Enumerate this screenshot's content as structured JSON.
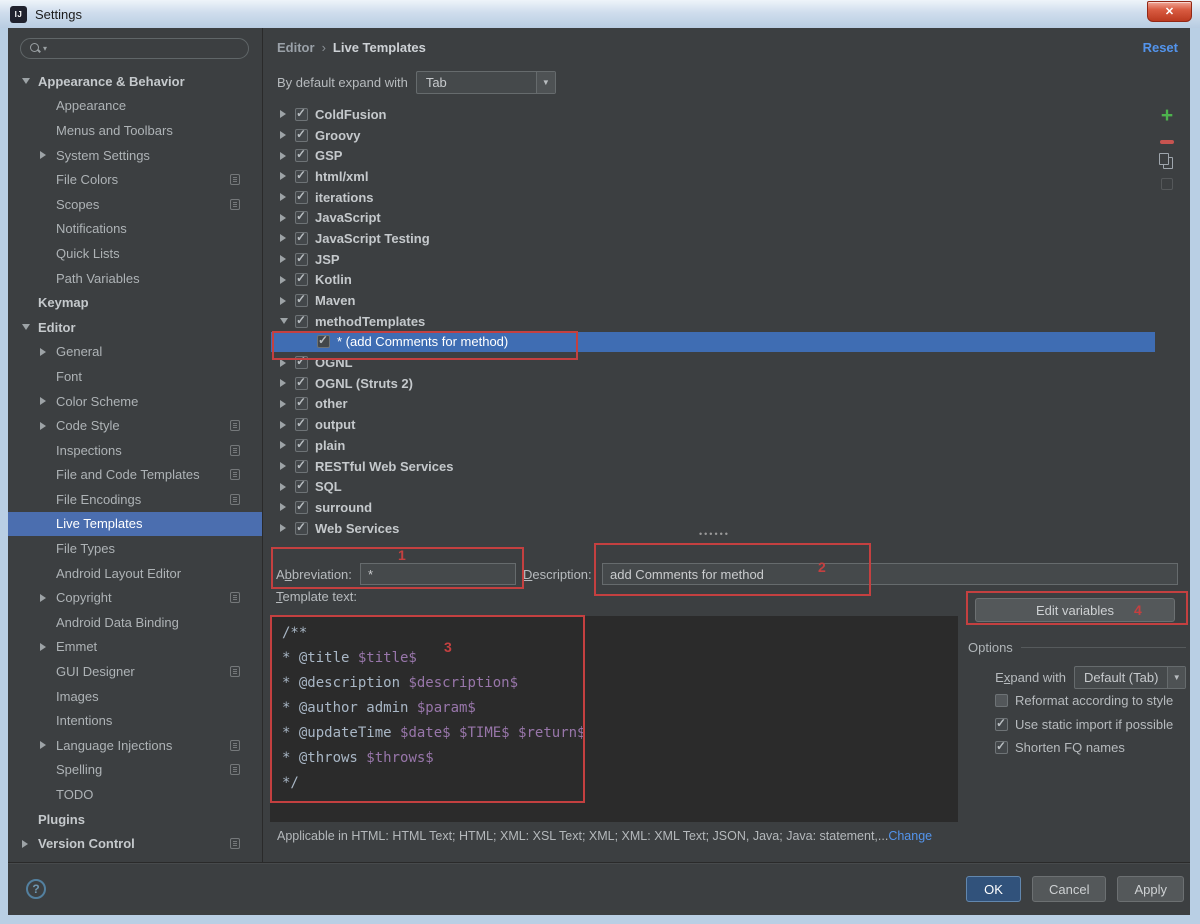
{
  "titlebar": {
    "title": "Settings",
    "app_icon_text": "IJ",
    "close_glyph": "✕"
  },
  "sidebar": {
    "search_value": "",
    "items": [
      {
        "label": "Appearance & Behavior",
        "level": 0,
        "arrow": "down",
        "bold": true,
        "selected": false,
        "badge": false
      },
      {
        "label": "Appearance",
        "level": 1,
        "arrow": null,
        "bold": false,
        "selected": false,
        "badge": false
      },
      {
        "label": "Menus and Toolbars",
        "level": 1,
        "arrow": null,
        "bold": false,
        "selected": false,
        "badge": false
      },
      {
        "label": "System Settings",
        "level": 1,
        "arrow": "right",
        "bold": false,
        "selected": false,
        "badge": false
      },
      {
        "label": "File Colors",
        "level": 1,
        "arrow": null,
        "bold": false,
        "selected": false,
        "badge": true
      },
      {
        "label": "Scopes",
        "level": 1,
        "arrow": null,
        "bold": false,
        "selected": false,
        "badge": true
      },
      {
        "label": "Notifications",
        "level": 1,
        "arrow": null,
        "bold": false,
        "selected": false,
        "badge": false
      },
      {
        "label": "Quick Lists",
        "level": 1,
        "arrow": null,
        "bold": false,
        "selected": false,
        "badge": false
      },
      {
        "label": "Path Variables",
        "level": 1,
        "arrow": null,
        "bold": false,
        "selected": false,
        "badge": false
      },
      {
        "label": "Keymap",
        "level": 0,
        "arrow": null,
        "bold": true,
        "selected": false,
        "badge": false
      },
      {
        "label": "Editor",
        "level": 0,
        "arrow": "down",
        "bold": true,
        "selected": false,
        "badge": false
      },
      {
        "label": "General",
        "level": 1,
        "arrow": "right",
        "bold": false,
        "selected": false,
        "badge": false
      },
      {
        "label": "Font",
        "level": 1,
        "arrow": null,
        "bold": false,
        "selected": false,
        "badge": false
      },
      {
        "label": "Color Scheme",
        "level": 1,
        "arrow": "right",
        "bold": false,
        "selected": false,
        "badge": false
      },
      {
        "label": "Code Style",
        "level": 1,
        "arrow": "right",
        "bold": false,
        "selected": false,
        "badge": true
      },
      {
        "label": "Inspections",
        "level": 1,
        "arrow": null,
        "bold": false,
        "selected": false,
        "badge": true
      },
      {
        "label": "File and Code Templates",
        "level": 1,
        "arrow": null,
        "bold": false,
        "selected": false,
        "badge": true
      },
      {
        "label": "File Encodings",
        "level": 1,
        "arrow": null,
        "bold": false,
        "selected": false,
        "badge": true
      },
      {
        "label": "Live Templates",
        "level": 1,
        "arrow": null,
        "bold": false,
        "selected": true,
        "badge": false
      },
      {
        "label": "File Types",
        "level": 1,
        "arrow": null,
        "bold": false,
        "selected": false,
        "badge": false
      },
      {
        "label": "Android Layout Editor",
        "level": 1,
        "arrow": null,
        "bold": false,
        "selected": false,
        "badge": false
      },
      {
        "label": "Copyright",
        "level": 1,
        "arrow": "right",
        "bold": false,
        "selected": false,
        "badge": true
      },
      {
        "label": "Android Data Binding",
        "level": 1,
        "arrow": null,
        "bold": false,
        "selected": false,
        "badge": false
      },
      {
        "label": "Emmet",
        "level": 1,
        "arrow": "right",
        "bold": false,
        "selected": false,
        "badge": false
      },
      {
        "label": "GUI Designer",
        "level": 1,
        "arrow": null,
        "bold": false,
        "selected": false,
        "badge": true
      },
      {
        "label": "Images",
        "level": 1,
        "arrow": null,
        "bold": false,
        "selected": false,
        "badge": false
      },
      {
        "label": "Intentions",
        "level": 1,
        "arrow": null,
        "bold": false,
        "selected": false,
        "badge": false
      },
      {
        "label": "Language Injections",
        "level": 1,
        "arrow": "right",
        "bold": false,
        "selected": false,
        "badge": true
      },
      {
        "label": "Spelling",
        "level": 1,
        "arrow": null,
        "bold": false,
        "selected": false,
        "badge": true
      },
      {
        "label": "TODO",
        "level": 1,
        "arrow": null,
        "bold": false,
        "selected": false,
        "badge": false
      },
      {
        "label": "Plugins",
        "level": 0,
        "arrow": null,
        "bold": true,
        "selected": false,
        "badge": false
      },
      {
        "label": "Version Control",
        "level": 0,
        "arrow": "right",
        "bold": true,
        "selected": false,
        "badge": true
      }
    ]
  },
  "main": {
    "breadcrumb": {
      "parent": "Editor",
      "separator": "›",
      "current": "Live Templates"
    },
    "reset_label": "Reset",
    "expand_with_label": "By default expand with",
    "expand_with_value": "Tab",
    "tree_items": [
      {
        "label": "ColdFusion",
        "level": 0,
        "arrow": "right",
        "checked": true,
        "selected": false
      },
      {
        "label": "Groovy",
        "level": 0,
        "arrow": "right",
        "checked": true,
        "selected": false
      },
      {
        "label": "GSP",
        "level": 0,
        "arrow": "right",
        "checked": true,
        "selected": false
      },
      {
        "label": "html/xml",
        "level": 0,
        "arrow": "right",
        "checked": true,
        "selected": false
      },
      {
        "label": "iterations",
        "level": 0,
        "arrow": "right",
        "checked": true,
        "selected": false
      },
      {
        "label": "JavaScript",
        "level": 0,
        "arrow": "right",
        "checked": true,
        "selected": false
      },
      {
        "label": "JavaScript Testing",
        "level": 0,
        "arrow": "right",
        "checked": true,
        "selected": false
      },
      {
        "label": "JSP",
        "level": 0,
        "arrow": "right",
        "checked": true,
        "selected": false
      },
      {
        "label": "Kotlin",
        "level": 0,
        "arrow": "right",
        "checked": true,
        "selected": false
      },
      {
        "label": "Maven",
        "level": 0,
        "arrow": "right",
        "checked": true,
        "selected": false
      },
      {
        "label": "methodTemplates",
        "level": 0,
        "arrow": "down",
        "checked": true,
        "selected": false
      },
      {
        "label": "* (add Comments for method)",
        "level": 1,
        "arrow": null,
        "checked": true,
        "selected": true
      },
      {
        "label": "OGNL",
        "level": 0,
        "arrow": "right",
        "checked": true,
        "selected": false
      },
      {
        "label": "OGNL (Struts 2)",
        "level": 0,
        "arrow": "right",
        "checked": true,
        "selected": false
      },
      {
        "label": "other",
        "level": 0,
        "arrow": "right",
        "checked": true,
        "selected": false
      },
      {
        "label": "output",
        "level": 0,
        "arrow": "right",
        "checked": true,
        "selected": false
      },
      {
        "label": "plain",
        "level": 0,
        "arrow": "right",
        "checked": true,
        "selected": false
      },
      {
        "label": "RESTful Web Services",
        "level": 0,
        "arrow": "right",
        "checked": true,
        "selected": false
      },
      {
        "label": "SQL",
        "level": 0,
        "arrow": "right",
        "checked": true,
        "selected": false
      },
      {
        "label": "surround",
        "level": 0,
        "arrow": "right",
        "checked": true,
        "selected": false
      },
      {
        "label": "Web Services",
        "level": 0,
        "arrow": "right",
        "checked": true,
        "selected": false
      }
    ],
    "toolbar": {
      "add_icon": "+",
      "remove_icon": "−",
      "copy_icon": "copy",
      "paste_icon": "paste"
    },
    "form": {
      "abbreviation_label": {
        "pre": "A",
        "m": "b",
        "post": "breviation:"
      },
      "abbreviation_value": "*",
      "description_label": {
        "pre": "",
        "m": "D",
        "post": "escription:"
      },
      "description_value": "add Comments for method",
      "template_text_label": {
        "pre": "",
        "m": "T",
        "post": "emplate text:"
      }
    },
    "editor_lines": [
      "/**",
      " * @title $title$",
      " * @description $description$",
      " * @author admin $param$",
      " * @updateTime $date$ $TIME$ $return$",
      " * @throws $throws$",
      " */"
    ],
    "edit_variables_label": {
      "pre": "",
      "m": "E",
      "post": "dit variables"
    },
    "options": {
      "header": "Options",
      "expand_with_label": {
        "pre": "E",
        "m": "x",
        "post": "pand with"
      },
      "expand_with_value": "Default (Tab)",
      "checkboxes": [
        {
          "pre": "",
          "m": "R",
          "post": "eformat according to style",
          "checked": false
        },
        {
          "pre": "Use static ",
          "m": "i",
          "post": "mport if possible",
          "checked": true
        },
        {
          "pre": "Shorten ",
          "m": "FQ",
          "post": " names",
          "checked": true
        }
      ]
    },
    "applicable": {
      "text": "Applicable in HTML: HTML Text; HTML; XML: XSL Text; XML; XML: XML Text; JSON, Java; Java: statement,...",
      "link": "Change"
    }
  },
  "bottombar": {
    "help_glyph": "?",
    "ok_label": "OK",
    "cancel_label": "Cancel",
    "apply_label": {
      "pre": "",
      "m": "A",
      "post": "pply"
    }
  },
  "annotations": {
    "n1": "1",
    "n2": "2",
    "n3": "3",
    "n4": "4"
  },
  "colors": {
    "selection_sidebar": "#4b6eaf",
    "selection_tree": "#3f6db3",
    "annotation_red": "#c44040",
    "link_blue": "#5394ec",
    "plus_green": "#4db34d",
    "minus_red": "#c75450",
    "editor_bg": "#2b2b2b",
    "variable_purple": "#9876aa",
    "panel_bg": "#3c3f41"
  }
}
